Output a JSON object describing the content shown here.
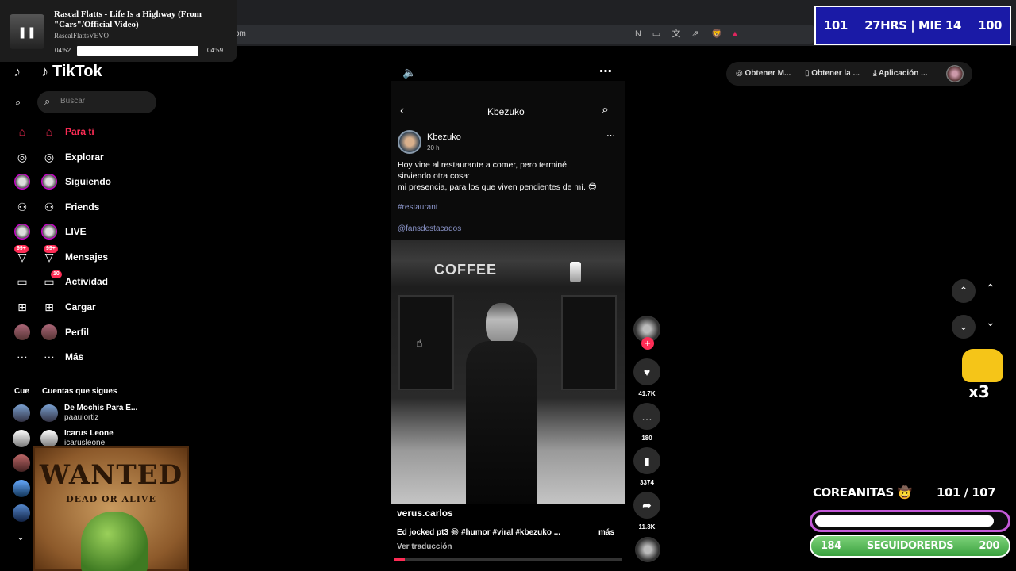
{
  "browser": {
    "url_fragment": "om",
    "extension_icons": [
      "N",
      "▭",
      "文",
      "⇗",
      "🦁",
      "▲"
    ]
  },
  "music": {
    "title": "Rascal Flatts - Life Is a Highway (From \"Cars\"/Official Video)",
    "artist": "RascalFlattsVEVO",
    "elapsed": "04:52",
    "duration": "04:59",
    "progress": 0.98
  },
  "hud": {
    "left": "101",
    "center": "27HRS | MIE 14",
    "right": "100"
  },
  "sidebar": {
    "logo": "TikTok",
    "search_placeholder": "Buscar",
    "items": [
      {
        "label": "Para ti",
        "icon": "home-icon",
        "glyph": "⌂",
        "active": true
      },
      {
        "label": "Explorar",
        "icon": "compass-icon",
        "glyph": "◎"
      },
      {
        "label": "Siguiendo",
        "icon": "following-avatar-icon",
        "glyph": "●"
      },
      {
        "label": "Friends",
        "icon": "friends-icon",
        "glyph": "⚇"
      },
      {
        "label": "LIVE",
        "icon": "live-avatar-icon",
        "glyph": "●"
      },
      {
        "label": "Mensajes",
        "icon": "messages-icon",
        "glyph": "▽",
        "badge": "99+"
      },
      {
        "label": "Actividad",
        "icon": "activity-icon",
        "glyph": "▭",
        "badge": "10"
      },
      {
        "label": "Cargar",
        "icon": "upload-icon",
        "glyph": "⊞"
      },
      {
        "label": "Perfil",
        "icon": "profile-avatar-icon",
        "glyph": "●"
      },
      {
        "label": "Más",
        "icon": "more-icon",
        "glyph": "⋯"
      }
    ],
    "following_heading_short": "Cue",
    "following_heading": "Cuentas que sigues",
    "accounts": [
      {
        "name": "De Mochis Para E...",
        "user": "paaulortiz"
      },
      {
        "name": "Icarus Leone",
        "user": "icarusleone"
      }
    ]
  },
  "wanted": {
    "title": "WANTED",
    "subtitle": "DEAD OR ALIVE"
  },
  "post": {
    "header_title": "Kbezuko",
    "author": "Kbezuko",
    "meta": "20 h ·",
    "text_lines": [
      "Hoy vine al restaurante a comer, pero terminé",
      "sirviendo otra cosa:",
      "mi presencia, para los que viven pendientes de mí. 😎"
    ],
    "hashtag": "#restaurant",
    "mention": "@fansdestacados",
    "photo_sign": "COFFEE",
    "creator": "verus.carlos",
    "caption": "Ed jocked pt3 😁 #humor #viral #kbezuko ...",
    "more": "más",
    "translate": "Ver traducción",
    "progress": 0.05
  },
  "actions": [
    {
      "icon": "heart-icon",
      "glyph": "♥",
      "count": "41.7K"
    },
    {
      "icon": "comment-icon",
      "glyph": "…",
      "count": "180"
    },
    {
      "icon": "bookmark-icon",
      "glyph": "▮",
      "count": "3374"
    },
    {
      "icon": "share-icon",
      "glyph": "➦",
      "count": "11.3K"
    }
  ],
  "top_actions": [
    {
      "label": "Obtener M...",
      "icon": "coin-icon",
      "glyph": "◎"
    },
    {
      "label": "Obtener la ...",
      "icon": "phone-icon",
      "glyph": "▯"
    },
    {
      "label": "Aplicación ...",
      "icon": "download-icon",
      "glyph": "⤓"
    }
  ],
  "stream": {
    "goal_label": "COREANITAS 🤠",
    "goal_count": "101  /  107",
    "goal_progress": 0.94,
    "followers_left": "184",
    "followers_label": "SEGUIDORERDS",
    "followers_right": "200",
    "multiplier": "x3"
  }
}
